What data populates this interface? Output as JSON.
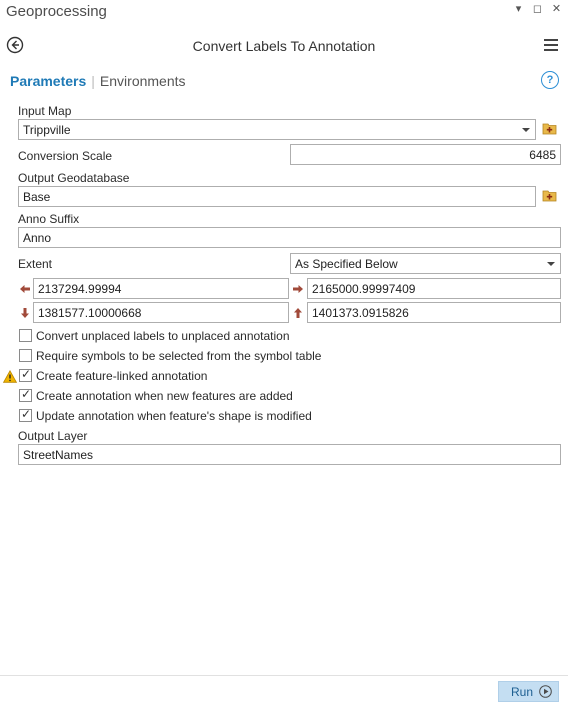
{
  "window": {
    "title": "Geoprocessing"
  },
  "tool": {
    "title": "Convert Labels To Annotation"
  },
  "tabs": {
    "parameters": "Parameters",
    "environments": "Environments"
  },
  "help_glyph": "?",
  "params": {
    "input_map": {
      "label": "Input Map",
      "value": "Trippville"
    },
    "conversion_scale": {
      "label": "Conversion Scale",
      "value": "6485"
    },
    "output_gdb": {
      "label": "Output Geodatabase",
      "value": "Base"
    },
    "anno_suffix": {
      "label": "Anno Suffix",
      "value": "Anno"
    },
    "extent": {
      "label": "Extent",
      "mode": "As Specified Below",
      "left": "2137294.99994",
      "right": "2165000.99997409",
      "bottom": "1381577.10000668",
      "top": "1401373.0915826"
    },
    "checks": [
      {
        "label": "Convert unplaced labels to unplaced annotation",
        "checked": false
      },
      {
        "label": "Require symbols to be selected from the symbol table",
        "checked": false
      },
      {
        "label": "Create feature-linked annotation",
        "checked": true,
        "warning": true
      },
      {
        "label": "Create annotation when new features are added",
        "checked": true
      },
      {
        "label": "Update annotation when feature's shape is modified",
        "checked": true
      }
    ],
    "output_layer": {
      "label": "Output Layer",
      "value": "StreetNames"
    }
  },
  "footer": {
    "run_label": "Run"
  },
  "colors": {
    "accent": "#1f7ab6",
    "run_bg": "#c4def2",
    "warning": "#f0b400"
  }
}
